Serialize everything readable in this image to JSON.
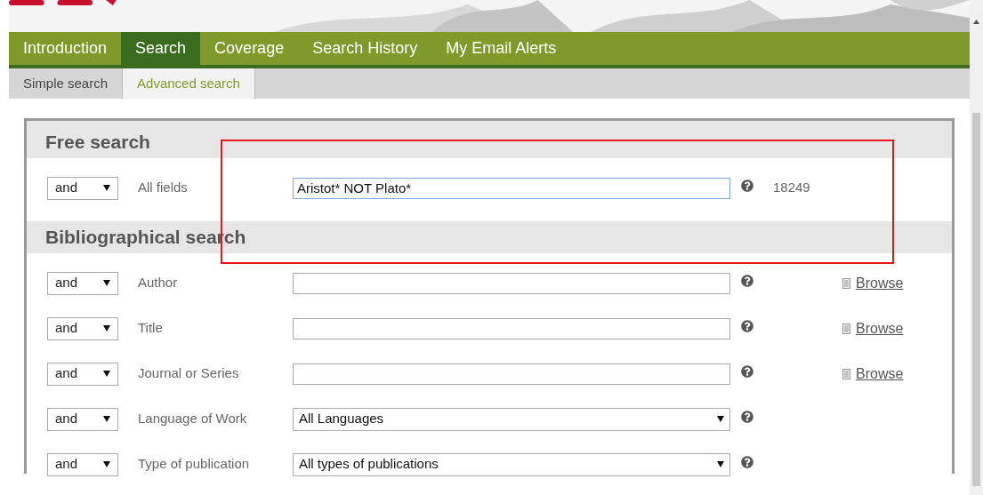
{
  "nav": {
    "tabs": [
      {
        "label": "Introduction",
        "selected": false
      },
      {
        "label": "Search",
        "selected": true
      },
      {
        "label": "Coverage",
        "selected": false
      },
      {
        "label": "Search History",
        "selected": false
      },
      {
        "label": "My Email Alerts",
        "selected": false
      }
    ]
  },
  "subtabs": [
    {
      "label": "Simple search",
      "selected": false
    },
    {
      "label": "Advanced search",
      "selected": true
    }
  ],
  "sections": [
    {
      "title": "Free search",
      "rows": [
        {
          "operator": "and",
          "label": "All fields",
          "kind": "text",
          "value": "Aristot* NOT Plato*",
          "focused": true,
          "count": "18249"
        }
      ]
    },
    {
      "title": "Bibliographical search",
      "rows": [
        {
          "operator": "and",
          "label": "Author",
          "kind": "text",
          "browse": "Browse"
        },
        {
          "operator": "and",
          "label": "Title",
          "kind": "text",
          "browse": "Browse"
        },
        {
          "operator": "and",
          "label": "Journal or Series",
          "kind": "text",
          "browse": "Browse"
        },
        {
          "operator": "and",
          "label": "Language of Work",
          "kind": "select",
          "value": "All Languages"
        },
        {
          "operator": "and",
          "label": "Type of publication",
          "kind": "select",
          "value": "All types of publications"
        }
      ]
    }
  ]
}
